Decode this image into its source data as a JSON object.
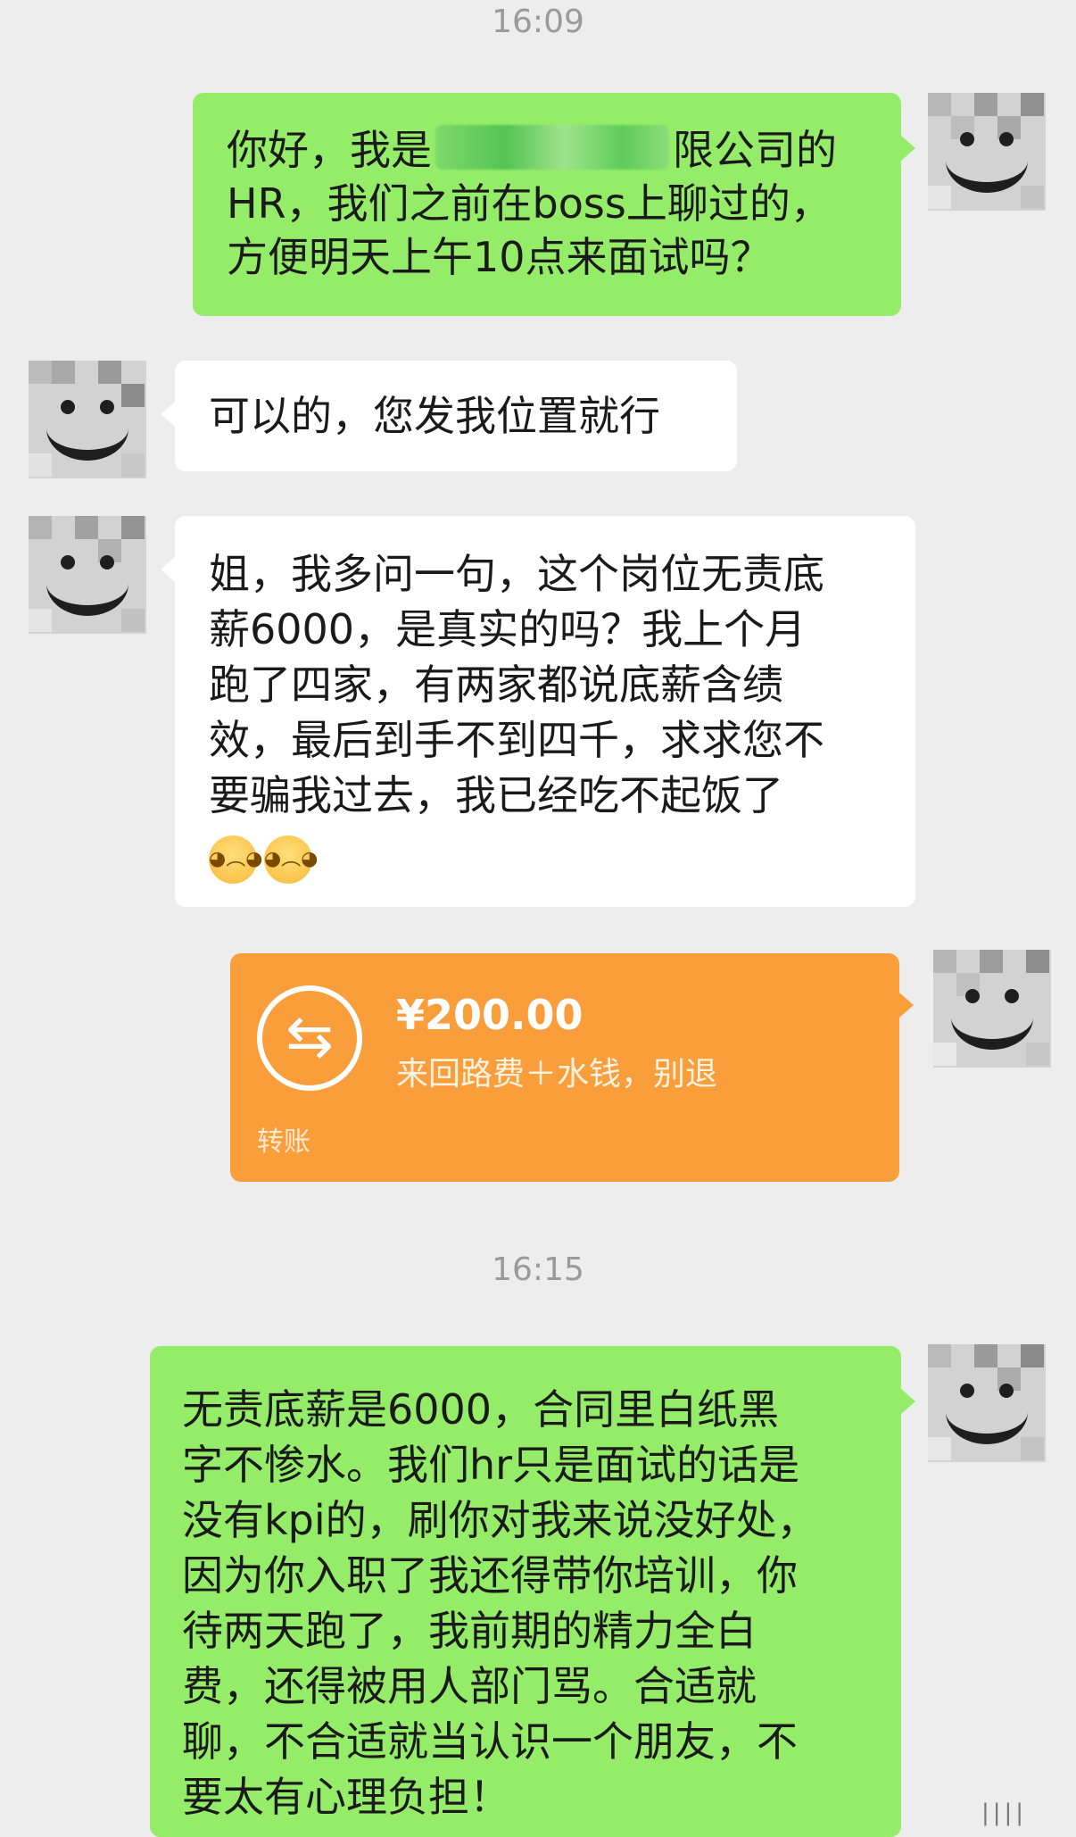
{
  "timestamps": [
    "16:09",
    "16:15"
  ],
  "messages": [
    {
      "side": "right",
      "type": "text",
      "lines": [
        "你好，我是",
        "限公司的",
        "HR，我们之前在boss上聊过的，",
        "方便明天上午10点来面试吗？"
      ]
    },
    {
      "side": "left",
      "type": "text",
      "lines": [
        "可以的，您发我位置就行"
      ]
    },
    {
      "side": "left",
      "type": "text",
      "lines": [
        "姐，我多问一句，这个岗位无责底",
        "薪6000，是真实的吗？我上个月",
        "跑了四家，有两家都说底薪含绩",
        "效，最后到手不到四千，求求您不",
        "要骗我过去，我已经吃不起饭了"
      ],
      "emojis": [
        "crying-face-icon",
        "crying-face-icon"
      ]
    },
    {
      "side": "right",
      "type": "transfer",
      "amount": "¥200.00",
      "note": "来回路费＋水钱，别退",
      "label": "转账",
      "icon": "transfer-arrows-icon",
      "color": "#fa9d3b"
    },
    {
      "side": "right",
      "type": "text",
      "lines": [
        "无责底薪是6000，合同里白纸黑",
        "字不惨水。我们hr只是面试的话是",
        "没有kpi的，刷你对我来说没好处，",
        "因为你入职了我还得带你培训，你",
        "待两天跑了，我前期的精力全白",
        "费，还得被用人部门骂。合适就",
        "聊，不合适就当认识一个朋友，不",
        "要太有心理负担！"
      ]
    }
  ],
  "colors": {
    "background": "#ededed",
    "bubble_self": "#95ec69",
    "bubble_other": "#ffffff",
    "transfer": "#fa9d3b",
    "timestamp": "#9a9a9a"
  }
}
